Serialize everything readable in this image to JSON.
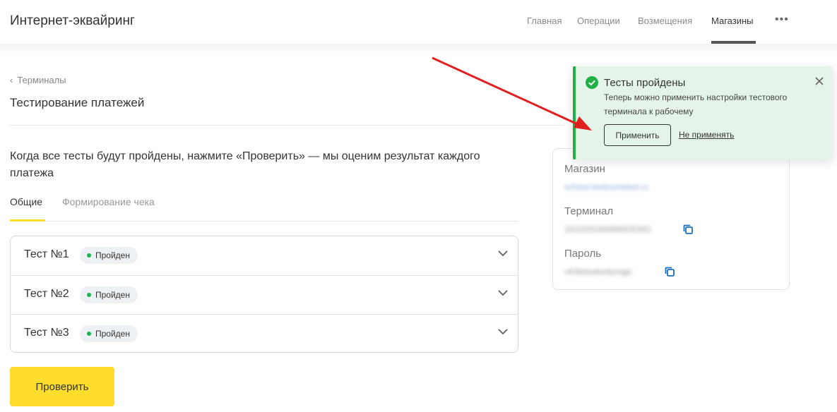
{
  "header": {
    "app_title": "Интернет-эквайринг",
    "nav": [
      "Главная",
      "Операции",
      "Возмещения",
      "Магазины"
    ],
    "active_nav": "Магазины",
    "more_label": "•••"
  },
  "breadcrumb": {
    "label": "Терминалы"
  },
  "page": {
    "title": "Тестирование платежей",
    "intro": "Когда все тесты будут пройдены, нажмите «Проверить» — мы оценим результат каждого платежа",
    "tabs": [
      "Общие",
      "Формирование чека"
    ],
    "active_tab": "Общие"
  },
  "tests": [
    {
      "name": "Тест №1",
      "status": "Пройден"
    },
    {
      "name": "Тест №2",
      "status": "Пройден"
    },
    {
      "name": "Тест №3",
      "status": "Пройден"
    }
  ],
  "check_button": "Проверить",
  "info": {
    "shop_label": "Магазин",
    "shop_value": "school.tesilcomebel.ru",
    "terminal_label": "Терминал",
    "terminal_value": "1610291666666DEMO",
    "password_label": "Пароль",
    "password_value": "v63bdsabxdymgjc"
  },
  "toast": {
    "title": "Тесты пройдены",
    "text": "Теперь можно применить настройки тестового терминала к рабочему",
    "apply_label": "Применить",
    "reject_label": "Не применять"
  },
  "colors": {
    "accent_yellow": "#ffdd2d",
    "success_green": "#1fb146",
    "toast_bg": "#e5f4e9",
    "annotation_red": "#e02020",
    "link_blue": "#1a6fc2"
  },
  "icons": [
    "chevron-left-icon",
    "more-dots-icon",
    "chevron-down-icon",
    "copy-icon",
    "check-circle-icon",
    "close-icon",
    "annotation-arrow"
  ]
}
